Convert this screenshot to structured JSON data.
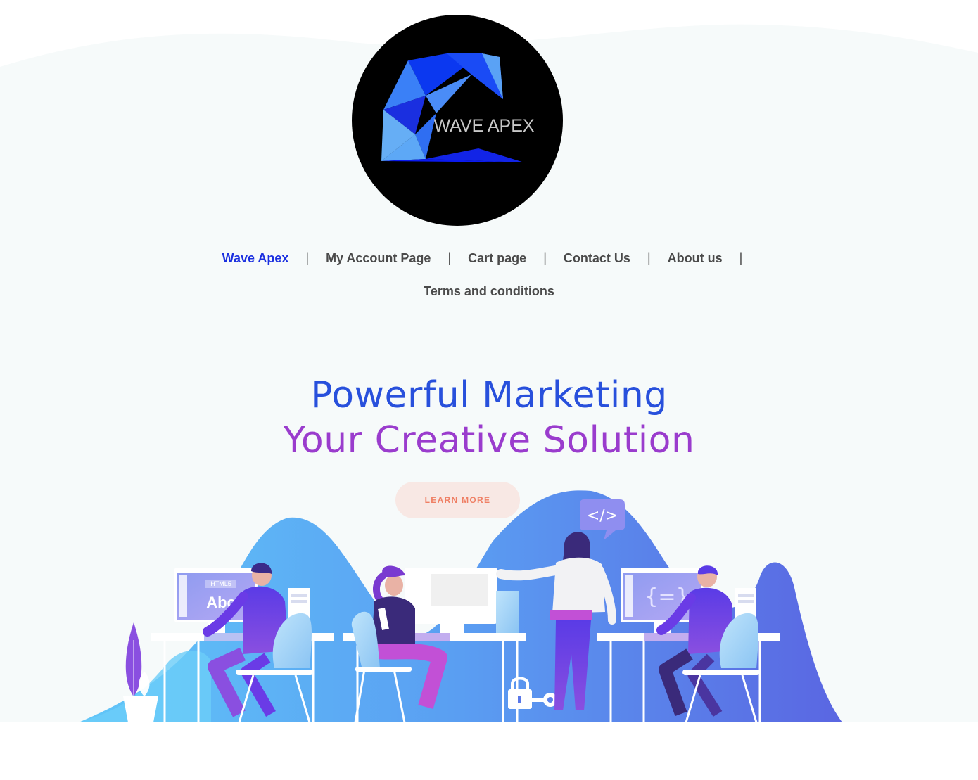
{
  "logo": {
    "text": "WAVE APEX",
    "colors": {
      "background": "#000000",
      "blue_primary": "#0b1af0",
      "blue_light": "#5aa2f5"
    }
  },
  "nav": {
    "items": [
      {
        "label": "Wave Apex",
        "active": true
      },
      {
        "label": "My Account Page",
        "active": false
      },
      {
        "label": "Cart page",
        "active": false
      },
      {
        "label": "Contact Us",
        "active": false
      },
      {
        "label": "About us",
        "active": false
      },
      {
        "label": "Terms and conditions",
        "active": false
      }
    ],
    "separator": "|"
  },
  "hero": {
    "line1": "Powerful Marketing",
    "line2": "Your Creative Solution",
    "cta_label": "LEARN MORE"
  },
  "illustration": {
    "screen_left_tag": "HTML5",
    "screen_left_text": "Abc",
    "screen_right_text": "{=}",
    "bubble_text": "</>"
  },
  "colors": {
    "accent_blue": "#2850dc",
    "accent_purple": "#9a3ccd",
    "cta_text": "#ef7f64",
    "cta_bg": "#f8e8e4",
    "nav_active": "#1a2fe0",
    "nav_text": "#4a4a4a"
  }
}
